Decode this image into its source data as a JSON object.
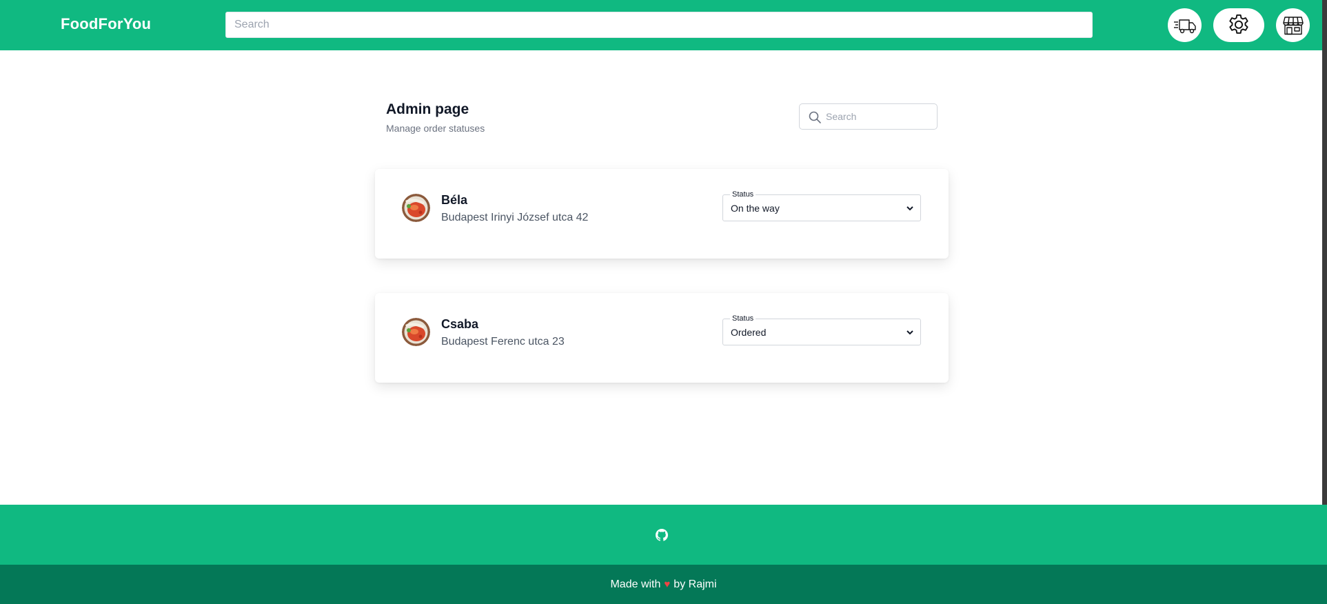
{
  "header": {
    "brand": "FoodForYou",
    "search_placeholder": "Search",
    "icons": [
      "truck-icon",
      "gear-icon",
      "store-icon"
    ],
    "accent_color": "#10b981"
  },
  "main": {
    "title": "Admin page",
    "subtitle": "Manage order statuses",
    "search_placeholder": "Search",
    "orders": [
      {
        "name": "Béla",
        "address": "Budapest Irinyi József utca 42",
        "status_label": "Status",
        "status": "On the way"
      },
      {
        "name": "Csaba",
        "address": "Budapest Ferenc utca 23",
        "status_label": "Status",
        "status": "Ordered"
      }
    ]
  },
  "footer": {
    "github_icon": "github-icon",
    "made_with": "Made with",
    "by": "by Rajmi",
    "top_color": "#10b981",
    "bottom_color": "#047857"
  }
}
